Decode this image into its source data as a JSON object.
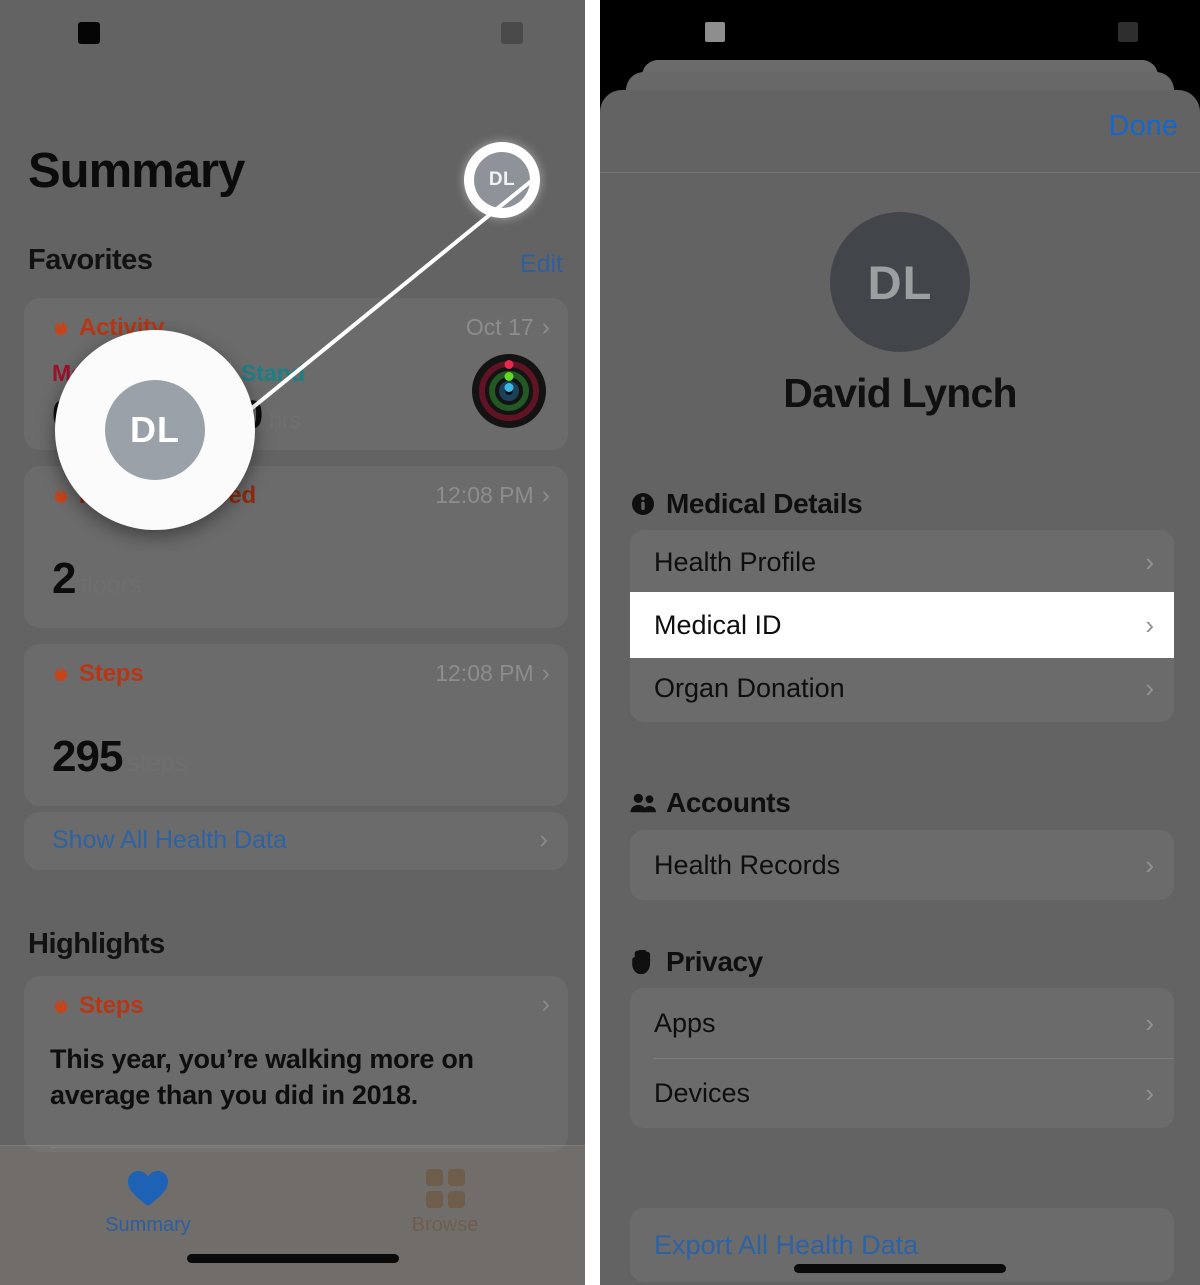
{
  "left": {
    "status": {
      "redacted_left": "",
      "redacted_right": ""
    },
    "title": "Summary",
    "avatar": {
      "initials": "DL",
      "name": "profile-avatar"
    },
    "favorites": {
      "heading": "Favorites",
      "edit_label": "Edit",
      "cards": [
        {
          "icon": "flame-icon",
          "name": "Activity",
          "timestamp": "Oct 17",
          "columns": [
            {
              "label": "Move",
              "value": "0",
              "unit": ""
            },
            {
              "label": "Stand",
              "value": "0",
              "unit": "hrs"
            }
          ]
        },
        {
          "icon": "flame-icon",
          "name": "Flights Climbed",
          "timestamp": "12:08 PM",
          "value": "2",
          "unit": "floors"
        },
        {
          "icon": "flame-icon",
          "name": "Steps",
          "timestamp": "12:08 PM",
          "value": "295",
          "unit": "steps"
        }
      ],
      "show_all_label": "Show All Health Data"
    },
    "highlights": {
      "heading": "Highlights",
      "card": {
        "icon": "flame-icon",
        "name": "Steps",
        "body": "This year, you’re walking more on average than you did in 2018."
      }
    },
    "tabs": [
      {
        "label": "Summary",
        "icon": "heart-icon",
        "active": true
      },
      {
        "label": "Browse",
        "icon": "grid-icon",
        "active": false
      }
    ],
    "magnifier": {
      "initials": "DL"
    }
  },
  "right": {
    "done_label": "Done",
    "avatar": {
      "initials": "DL"
    },
    "person_name": "David Lynch",
    "sections": [
      {
        "heading": "Medical Details",
        "icon": "info-circle-icon",
        "rows": [
          {
            "label": "Health Profile",
            "highlighted": false
          },
          {
            "label": "Medical ID",
            "highlighted": true
          },
          {
            "label": "Organ Donation",
            "highlighted": false
          }
        ]
      },
      {
        "heading": "Accounts",
        "icon": "people-icon",
        "rows": [
          {
            "label": "Health Records",
            "highlighted": false
          }
        ]
      },
      {
        "heading": "Privacy",
        "icon": "hand-raised-icon",
        "rows": [
          {
            "label": "Apps",
            "highlighted": false
          },
          {
            "label": "Devices",
            "highlighted": false
          }
        ]
      }
    ],
    "export_label": "Export All Health Data"
  },
  "colors": {
    "accent_blue": "#2d62a5",
    "done_blue": "#1367cf",
    "activity_red": "#b63715",
    "move_red": "#a1102c",
    "stand_teal": "#1b7f86",
    "dimmed_bg": "#636363",
    "highlight_white": "#ffffff"
  }
}
